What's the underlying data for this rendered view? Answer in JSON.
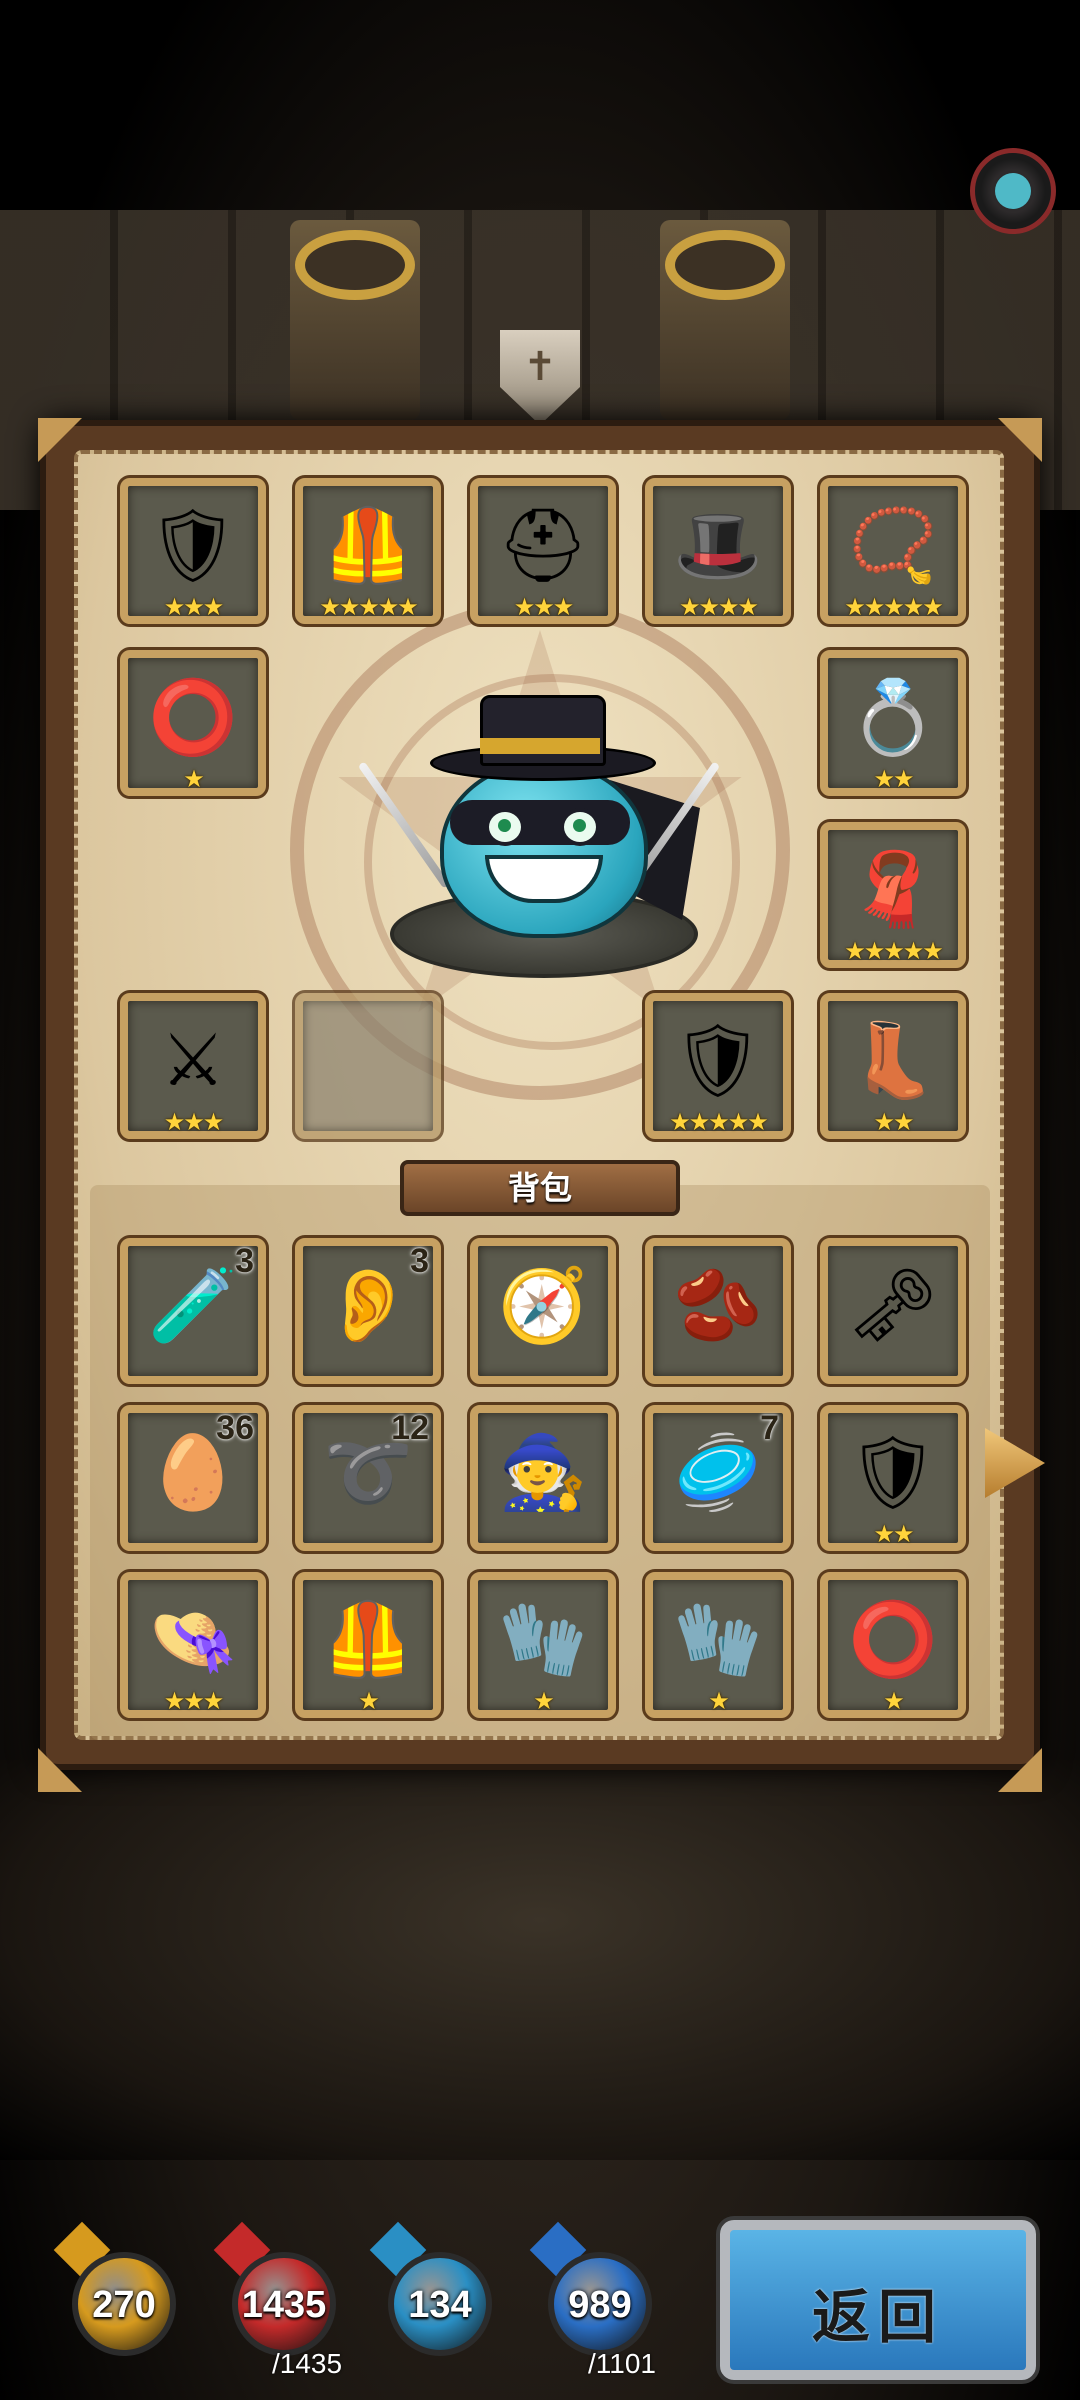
{
  "equipment": [
    {
      "id": "eq-gauntlet",
      "icon": "gold-armor-piece-icon",
      "glyph": "🛡",
      "stars": "★★★"
    },
    {
      "id": "eq-armor",
      "icon": "knight-armor-icon",
      "glyph": "🦺",
      "stars": "★★★★★"
    },
    {
      "id": "eq-helmet",
      "icon": "spartan-helmet-icon",
      "glyph": "⛑",
      "stars": "★★★"
    },
    {
      "id": "eq-witch-hat",
      "icon": "purple-witch-hat-icon",
      "glyph": "🎩",
      "stars": "★★★★"
    },
    {
      "id": "eq-necklace",
      "icon": "star-necklace-icon",
      "glyph": "📿",
      "stars": "★★★★★"
    },
    {
      "id": "eq-ring-left",
      "icon": "silver-ring-icon",
      "glyph": "⭕",
      "stars": "★"
    },
    {
      "id": "eq-ring-right",
      "icon": "emerald-ring-icon",
      "glyph": "💍",
      "stars": "★★"
    },
    {
      "id": "eq-cape",
      "icon": "red-cape-icon",
      "glyph": "🧣",
      "stars": "★★★★★"
    },
    {
      "id": "eq-swords",
      "icon": "crossed-swords-icon",
      "glyph": "⚔",
      "stars": "★★★"
    },
    {
      "id": "eq-empty",
      "icon": "empty-slot-mask-icon",
      "glyph": "",
      "stars": ""
    },
    {
      "id": "eq-shield",
      "icon": "gold-shield-icon",
      "glyph": "🛡",
      "stars": "★★★★★"
    },
    {
      "id": "eq-boots",
      "icon": "purple-boots-icon",
      "glyph": "👢",
      "stars": "★★"
    }
  ],
  "bag_label": "背包",
  "bag": [
    {
      "icon": "red-potion-icon",
      "glyph": "🧪",
      "count": "3",
      "stars": ""
    },
    {
      "icon": "pink-ear-icon",
      "glyph": "👂",
      "count": "3",
      "stars": ""
    },
    {
      "icon": "compass-icon",
      "glyph": "🧭",
      "count": "",
      "stars": ""
    },
    {
      "icon": "red-bean-icon",
      "glyph": "🫘",
      "count": "",
      "stars": ""
    },
    {
      "icon": "golden-key-icon",
      "glyph": "🗝",
      "count": "",
      "stars": ""
    },
    {
      "icon": "dragon-egg-icon",
      "glyph": "🥚",
      "count": "36",
      "stars": ""
    },
    {
      "icon": "purple-rope-icon",
      "glyph": "➰",
      "count": "12",
      "stars": ""
    },
    {
      "icon": "wizard-figure-icon",
      "glyph": "🧙",
      "count": "",
      "stars": ""
    },
    {
      "icon": "wooden-disc-icon",
      "glyph": "🥏",
      "count": "7",
      "stars": ""
    },
    {
      "icon": "blue-shield-icon",
      "glyph": "🛡",
      "count": "",
      "stars": "★★"
    },
    {
      "icon": "red-hat-icon",
      "glyph": "👒",
      "count": "",
      "stars": "★★★"
    },
    {
      "icon": "steel-armor-icon",
      "glyph": "🦺",
      "count": "",
      "stars": "★"
    },
    {
      "icon": "steel-glove-icon",
      "glyph": "🧤",
      "count": "",
      "stars": "★"
    },
    {
      "icon": "iron-gauntlet-icon",
      "glyph": "🧤",
      "count": "",
      "stars": "★"
    },
    {
      "icon": "silver-ring-icon",
      "glyph": "⭕",
      "count": "",
      "stars": "★"
    }
  ],
  "stats": [
    {
      "name": "attack",
      "icon": "sword-icon",
      "value": "270",
      "max": "",
      "color": "#d69a1e"
    },
    {
      "name": "health",
      "icon": "heart-potion-icon",
      "value": "1435",
      "max": "/1435",
      "color": "#c42a2a"
    },
    {
      "name": "magic",
      "icon": "staff-icon",
      "value": "134",
      "max": "",
      "color": "#2a8fc4"
    },
    {
      "name": "mana",
      "icon": "mana-potion-icon",
      "value": "989",
      "max": "/1101",
      "color": "#2a6ec4"
    }
  ],
  "back_button": "返回"
}
